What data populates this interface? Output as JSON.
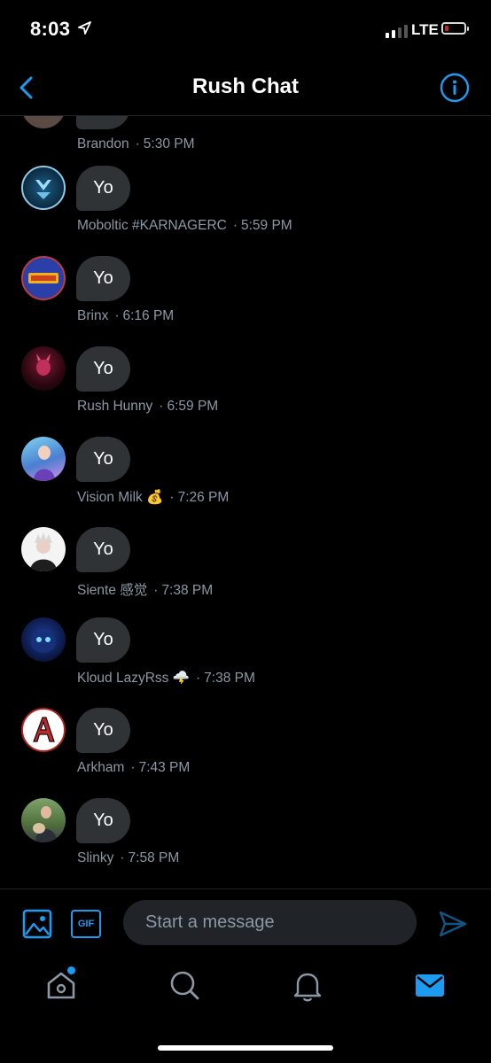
{
  "status": {
    "time": "8:03",
    "network": "LTE",
    "battery_color": "#e0302a"
  },
  "header": {
    "title": "Rush Chat"
  },
  "messages": [
    {
      "sender": "Brandon",
      "time": "5:30 PM",
      "text": ""
    },
    {
      "sender": "Moboltic #KARNAGERC",
      "time": "5:59 PM",
      "text": "Yo"
    },
    {
      "sender": "Brinx",
      "time": "6:16 PM",
      "text": "Yo"
    },
    {
      "sender": "Rush Hunny",
      "time": "6:59 PM",
      "text": "Yo"
    },
    {
      "sender": "Vision Milk 💰",
      "time": "7:26 PM",
      "text": "Yo"
    },
    {
      "sender": "Siente 感觉",
      "time": "7:38 PM",
      "text": "Yo"
    },
    {
      "sender": "Kloud LazyRss 🌩️",
      "time": "7:38 PM",
      "text": "Yo"
    },
    {
      "sender": "Arkham",
      "time": "7:43 PM",
      "text": "Yo"
    },
    {
      "sender": "Slinky",
      "time": "7:58 PM",
      "text": "Yo"
    }
  ],
  "composer": {
    "placeholder": "Start a message",
    "gif_label": "GIF"
  },
  "tabs": {
    "home": "home-icon",
    "search": "search-icon",
    "notifications": "bell-icon",
    "messages": "mail-icon",
    "active": "messages"
  },
  "colors": {
    "accent": "#1d9bf0",
    "bubble": "#2f3336",
    "meta": "#8b98a5",
    "background": "#000000"
  }
}
